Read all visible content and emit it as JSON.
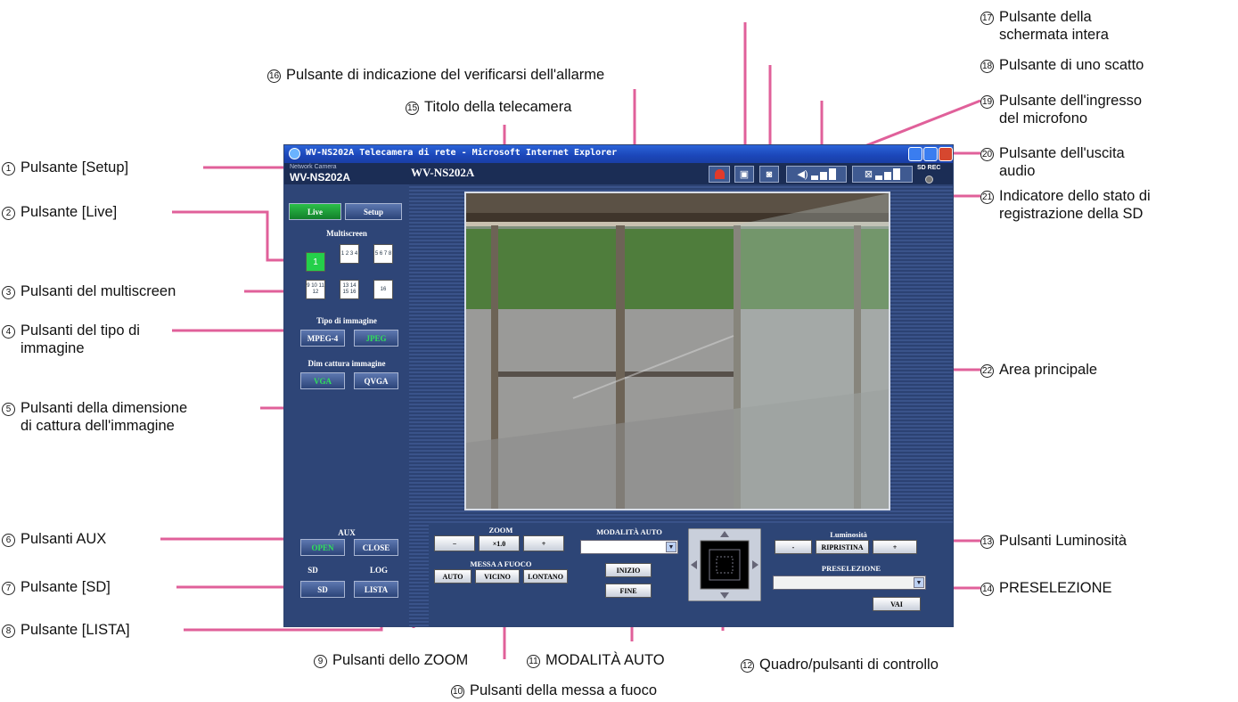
{
  "window": {
    "title": "WV-NS202A Telecamera di rete - Microsoft Internet Explorer",
    "brand_small": "Network Camera",
    "brand_model": "WV-NS202A",
    "camera_title": "WV-NS202A",
    "sd_rec_label": "SD REC"
  },
  "left_panel": {
    "live_button": "Live",
    "setup_button": "Setup",
    "multiscreen_heading": "Multiscreen",
    "multiscreen_buttons": [
      "1",
      "1 2 3 4",
      "5 6 7 8",
      "9 10 11 12",
      "13 14 15 16",
      "16"
    ],
    "image_type_heading": "Tipo di immagine",
    "image_type_buttons": [
      "MPEG-4",
      "JPEG"
    ],
    "capture_size_heading": "Dim cattura immagine",
    "capture_size_buttons": [
      "VGA",
      "QVGA"
    ],
    "aux_heading": "AUX",
    "aux_buttons": [
      "OPEN",
      "CLOSE"
    ],
    "sd_heading": "SD",
    "log_heading": "LOG",
    "sd_button": "SD",
    "list_button": "LISTA"
  },
  "controls": {
    "zoom_heading": "ZOOM",
    "zoom_out": "−",
    "zoom_value": "×1.0",
    "zoom_in": "+",
    "focus_heading": "MESSA A FUOCO",
    "focus_buttons": [
      "AUTO",
      "VICINO",
      "LONTANO"
    ],
    "auto_mode_heading": "MODALITÀ AUTO",
    "auto_mode_start": "INIZIO",
    "auto_mode_end": "FINE",
    "brightness_heading": "Luminosità",
    "brightness_minus": "-",
    "brightness_reset": "RIPRISTINA",
    "brightness_plus": "+",
    "preset_heading": "PRESELEZIONE",
    "preset_go": "VAI"
  },
  "callouts": {
    "c1": {
      "num": "1",
      "text": "Pulsante [Setup]"
    },
    "c2": {
      "num": "2",
      "text": "Pulsante [Live]"
    },
    "c3": {
      "num": "3",
      "text": "Pulsanti del multiscreen"
    },
    "c4": {
      "num": "4",
      "line1": "Pulsanti del tipo di",
      "line2": "immagine"
    },
    "c5": {
      "num": "5",
      "line1": "Pulsanti della dimensione",
      "line2": "di cattura dell'immagine"
    },
    "c6": {
      "num": "6",
      "text": "Pulsanti AUX"
    },
    "c7": {
      "num": "7",
      "text": "Pulsante [SD]"
    },
    "c8": {
      "num": "8",
      "text": "Pulsante [LISTA]"
    },
    "c9": {
      "num": "9",
      "text": "Pulsanti dello ZOOM"
    },
    "c10": {
      "num": "10",
      "text": "Pulsanti della messa a fuoco"
    },
    "c11": {
      "num": "11",
      "text": "MODALITÀ AUTO"
    },
    "c12": {
      "num": "12",
      "text": "Quadro/pulsanti di controllo"
    },
    "c13": {
      "num": "13",
      "text": "Pulsanti Luminosità"
    },
    "c14": {
      "num": "14",
      "text": "PRESELEZIONE"
    },
    "c15": {
      "num": "15",
      "text": "Titolo della telecamera"
    },
    "c16": {
      "num": "16",
      "text": "Pulsante di indicazione del verificarsi dell'allarme"
    },
    "c17": {
      "num": "17",
      "line1": "Pulsante della",
      "line2": "schermata intera"
    },
    "c18": {
      "num": "18",
      "text": "Pulsante di uno scatto"
    },
    "c19": {
      "num": "19",
      "line1": "Pulsante dell'ingresso",
      "line2": "del microfono"
    },
    "c20": {
      "num": "20",
      "line1": "Pulsante dell'uscita",
      "line2": "audio"
    },
    "c21": {
      "num": "21",
      "line1": "Indicatore dello stato di",
      "line2": "registrazione della SD"
    },
    "c22": {
      "num": "22",
      "text": "Area principale"
    }
  },
  "colors": {
    "callout_line": "#e0609a",
    "active_green": "#2ee05a",
    "panel_blue": "#2e4577"
  }
}
